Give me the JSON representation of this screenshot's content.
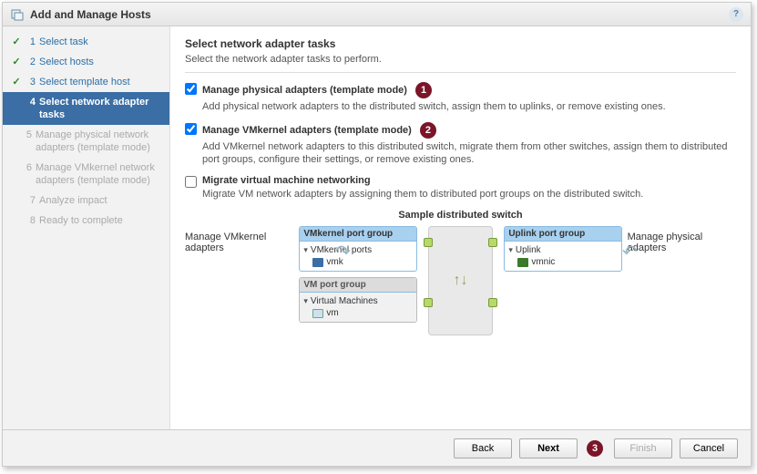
{
  "titlebar": {
    "title": "Add and Manage Hosts"
  },
  "sidebar": {
    "steps": [
      {
        "num": "1",
        "label": "Select task",
        "state": "done"
      },
      {
        "num": "2",
        "label": "Select hosts",
        "state": "done"
      },
      {
        "num": "3",
        "label": "Select template host",
        "state": "done"
      },
      {
        "num": "4",
        "label": "Select network adapter tasks",
        "state": "active"
      },
      {
        "num": "5",
        "label": "Manage physical network adapters (template mode)",
        "state": "sub"
      },
      {
        "num": "6",
        "label": "Manage VMkernel network adapters (template mode)",
        "state": "sub"
      },
      {
        "num": "7",
        "label": "Analyze impact",
        "state": "future"
      },
      {
        "num": "8",
        "label": "Ready to complete",
        "state": "future"
      }
    ]
  },
  "content": {
    "heading": "Select network adapter tasks",
    "subtitle": "Select the network adapter tasks to perform.",
    "options": [
      {
        "id": "opt-phys",
        "checked": true,
        "label": "Manage physical adapters (template mode)",
        "callout": "1",
        "desc": "Add physical network adapters to the distributed switch, assign them to uplinks, or remove existing ones."
      },
      {
        "id": "opt-vmk",
        "checked": true,
        "label": "Manage VMkernel adapters (template mode)",
        "callout": "2",
        "desc": "Add VMkernel network adapters to this distributed switch, migrate them from other switches, assign them to distributed port groups, configure their settings, or remove existing ones."
      },
      {
        "id": "opt-vmnet",
        "checked": false,
        "label": "Migrate virtual machine networking",
        "callout": "",
        "desc": "Migrate VM network adapters by assigning them to distributed port groups on the distributed switch."
      }
    ],
    "diagram": {
      "title": "Sample distributed switch",
      "left_hint": "Manage VMkernel adapters",
      "right_hint": "Manage physical adapters",
      "vmk_group": {
        "head": "VMkernel port group",
        "sub": "VMkernel ports",
        "item": "vmk"
      },
      "vm_group": {
        "head": "VM port group",
        "sub": "Virtual Machines",
        "item": "vm"
      },
      "uplink_group": {
        "head": "Uplink port group",
        "sub": "Uplink",
        "item": "vmnic"
      }
    }
  },
  "footer": {
    "back": "Back",
    "next": "Next",
    "next_callout": "3",
    "finish": "Finish",
    "cancel": "Cancel"
  }
}
